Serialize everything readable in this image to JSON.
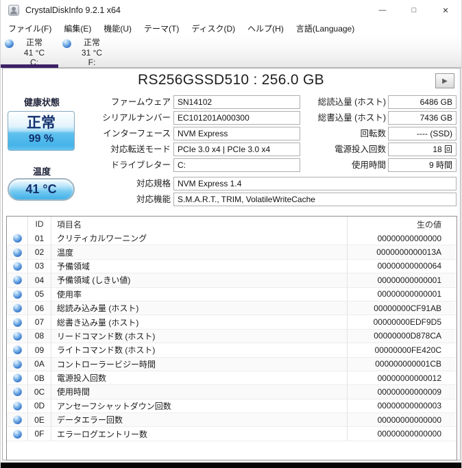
{
  "window": {
    "title": "CrystalDiskInfo 9.2.1 x64",
    "controls": {
      "minimize": "—",
      "maximize": "□",
      "close": "✕"
    }
  },
  "menu": {
    "items": [
      "ファイル(F)",
      "編集(E)",
      "機能(U)",
      "テーマ(T)",
      "ディスク(D)",
      "ヘルプ(H)",
      "言語(Language)"
    ]
  },
  "tabs": [
    {
      "status": "正常",
      "temperature": "41 °C",
      "letter": "C:"
    },
    {
      "status": "正常",
      "temperature": "31 °C",
      "letter": "F:"
    }
  ],
  "drive": {
    "model_title": "RS256GSSD510 : 256.0 GB"
  },
  "play_button_icon": "▶",
  "health": {
    "label": "健康状態",
    "status": "正常",
    "percent": "99 %"
  },
  "temperature": {
    "label": "温度",
    "value": "41 °C"
  },
  "fields_center": [
    {
      "label": "ファームウェア",
      "value": "SN14102"
    },
    {
      "label": "シリアルナンバー",
      "value": "EC101201A000300"
    },
    {
      "label": "インターフェース",
      "value": "NVM Express"
    },
    {
      "label": "対応転送モード",
      "value": "PCIe 3.0 x4 | PCIe 3.0 x4"
    },
    {
      "label": "ドライブレター",
      "value": "C:"
    }
  ],
  "fields_wide": [
    {
      "label": "対応規格",
      "value": "NVM Express 1.4"
    },
    {
      "label": "対応機能",
      "value": "S.M.A.R.T., TRIM, VolatileWriteCache"
    }
  ],
  "fields_right": [
    {
      "label": "総読込量 (ホスト)",
      "value": "6486 GB"
    },
    {
      "label": "総書込量 (ホスト)",
      "value": "7436 GB"
    },
    {
      "label": "回転数",
      "value": "---- (SSD)"
    },
    {
      "label": "電源投入回数",
      "value": "18 回"
    },
    {
      "label": "使用時間",
      "value": "9 時間"
    }
  ],
  "smart_table": {
    "headers": {
      "id": "ID",
      "name": "項目名",
      "raw": "生の値"
    },
    "rows": [
      {
        "id": "01",
        "name": "クリティカルワーニング",
        "raw": "00000000000000"
      },
      {
        "id": "02",
        "name": "温度",
        "raw": "0000000000013A"
      },
      {
        "id": "03",
        "name": "予備領域",
        "raw": "00000000000064"
      },
      {
        "id": "04",
        "name": "予備領域 (しきい値)",
        "raw": "00000000000001"
      },
      {
        "id": "05",
        "name": "使用率",
        "raw": "00000000000001"
      },
      {
        "id": "06",
        "name": "総読み込み量 (ホスト)",
        "raw": "00000000CF91AB"
      },
      {
        "id": "07",
        "name": "総書き込み量 (ホスト)",
        "raw": "00000000EDF9D5"
      },
      {
        "id": "08",
        "name": "リードコマンド数 (ホスト)",
        "raw": "00000000D878CA"
      },
      {
        "id": "09",
        "name": "ライトコマンド数 (ホスト)",
        "raw": "00000000FE420C"
      },
      {
        "id": "0A",
        "name": "コントローラービジー時間",
        "raw": "000000000001CB"
      },
      {
        "id": "0B",
        "name": "電源投入回数",
        "raw": "00000000000012"
      },
      {
        "id": "0C",
        "name": "使用時間",
        "raw": "00000000000009"
      },
      {
        "id": "0D",
        "name": "アンセーフシャットダウン回数",
        "raw": "00000000000003"
      },
      {
        "id": "0E",
        "name": "データエラー回数",
        "raw": "00000000000000"
      },
      {
        "id": "0F",
        "name": "エラーログエントリー数",
        "raw": "00000000000000"
      }
    ]
  },
  "colors": {
    "accent_underline": "#3c2166",
    "health_text": "#12306e",
    "good_status_blue": "#45b3e9"
  }
}
